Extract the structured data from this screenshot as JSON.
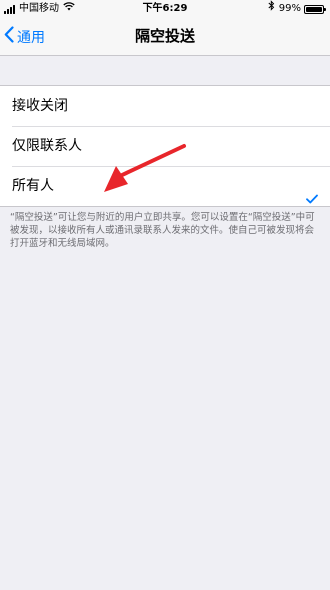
{
  "status_bar": {
    "carrier": "中国移动",
    "time": "下午6:29",
    "battery_percent": "99%",
    "battery_level": 0.99
  },
  "nav": {
    "back_label": "通用",
    "title": "隔空投送"
  },
  "options": [
    {
      "label": "接收关闭",
      "selected": false
    },
    {
      "label": "仅限联系人",
      "selected": false
    },
    {
      "label": "所有人",
      "selected": true
    }
  ],
  "footer": "“隔空投送”可让您与附近的用户立即共享。您可以设置在“隔空投送”中可被发现，以接收所有人或通讯录联系人发来的文件。使自己可被发现将会打开蓝牙和无线局域网。",
  "colors": {
    "accent": "#007aff",
    "annotation_arrow": "#e8262b"
  },
  "icons": [
    "signal-bars-icon",
    "wifi-icon",
    "bluetooth-icon",
    "battery-icon",
    "chevron-left-icon",
    "checkmark-icon"
  ]
}
